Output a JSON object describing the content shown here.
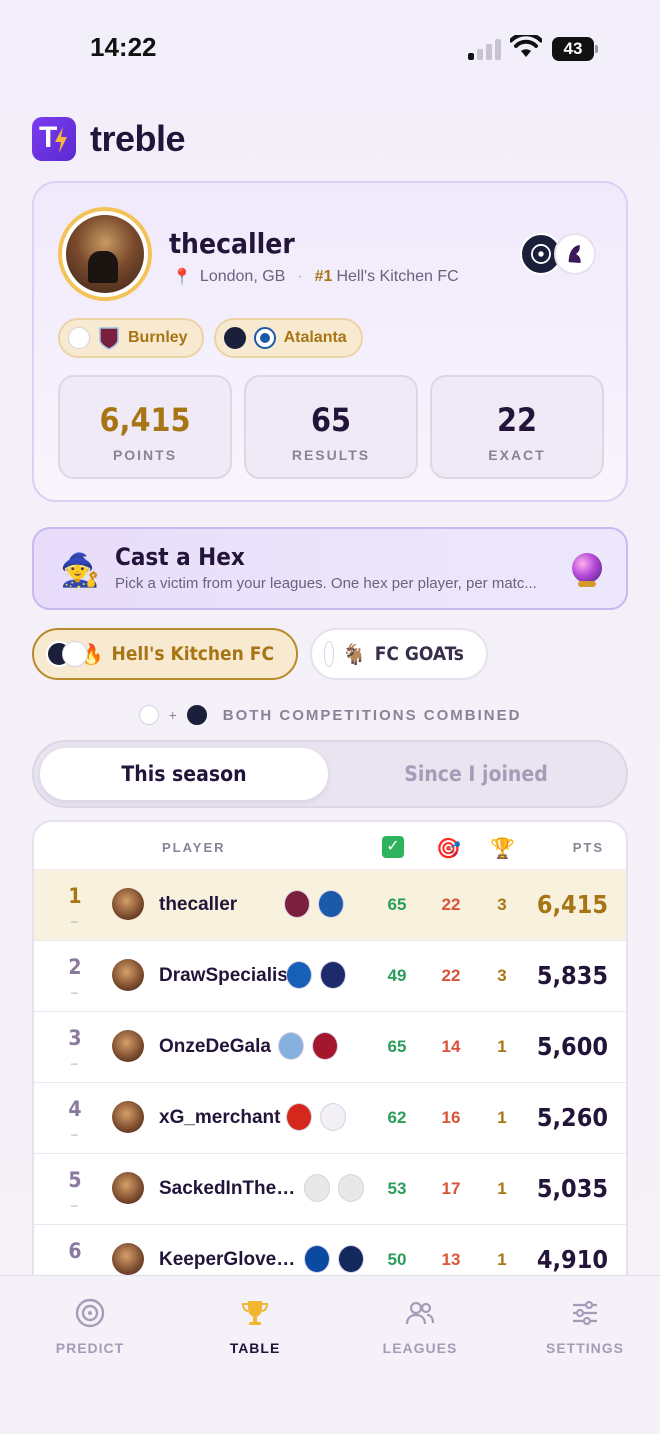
{
  "status_bar": {
    "time": "14:22",
    "battery": "43"
  },
  "app": {
    "name": "treble",
    "logo_letter": "T"
  },
  "profile": {
    "username": "thecaller",
    "location": "London, GB",
    "rank": "#1",
    "league": "Hell's Kitchen FC",
    "teams": [
      {
        "name": "Burnley",
        "competition": "premier-league"
      },
      {
        "name": "Atalanta",
        "competition": "champions-league"
      }
    ],
    "stats": [
      {
        "value": "6,415",
        "label": "POINTS"
      },
      {
        "value": "65",
        "label": "RESULTS"
      },
      {
        "value": "22",
        "label": "EXACT"
      }
    ]
  },
  "hex": {
    "title": "Cast a Hex",
    "subtitle": "Pick a victim from your leagues. One hex per player, per matc..."
  },
  "leagues": [
    {
      "name": "Hell's Kitchen FC",
      "emoji": "🔥",
      "active": true
    },
    {
      "name": "FC GOATs",
      "emoji": "🐐",
      "active": false
    }
  ],
  "combined_label": "BOTH COMPETITIONS COMBINED",
  "segmented": {
    "this_season": "This season",
    "since_joined": "Since I joined"
  },
  "table": {
    "headers": {
      "player": "PLAYER",
      "pts": "PTS"
    },
    "rows": [
      {
        "rank": "1",
        "name": "thecaller",
        "results": "65",
        "exact": "22",
        "trophies": "3",
        "points": "6,415",
        "crests": [
          "#7a1f3d",
          "#1a5aa8"
        ]
      },
      {
        "rank": "2",
        "name": "DrawSpecialist",
        "results": "49",
        "exact": "22",
        "trophies": "3",
        "points": "5,835",
        "crests": [
          "#1760b8",
          "#1d2a6b"
        ]
      },
      {
        "rank": "3",
        "name": "OnzeDeGala",
        "results": "65",
        "exact": "14",
        "trophies": "1",
        "points": "5,600",
        "crests": [
          "#86b0e0",
          "#a3162e"
        ]
      },
      {
        "rank": "4",
        "name": "xG_merchant",
        "results": "62",
        "exact": "16",
        "trophies": "1",
        "points": "5,260",
        "crests": [
          "#d4281c",
          "#f2f0f4"
        ]
      },
      {
        "rank": "5",
        "name": "SackedInThe…",
        "results": "53",
        "exact": "17",
        "trophies": "1",
        "points": "5,035",
        "crests": [
          "#e8e8e8",
          "#e8e8e8"
        ]
      },
      {
        "rank": "6",
        "name": "KeeperGlove…",
        "results": "50",
        "exact": "13",
        "trophies": "1",
        "points": "4,910",
        "crests": [
          "#0a4aa0",
          "#12295e"
        ]
      }
    ]
  },
  "tabbar": [
    {
      "label": "PREDICT",
      "active": false
    },
    {
      "label": "TABLE",
      "active": true
    },
    {
      "label": "LEAGUES",
      "active": false
    },
    {
      "label": "SETTINGS",
      "active": false
    }
  ]
}
